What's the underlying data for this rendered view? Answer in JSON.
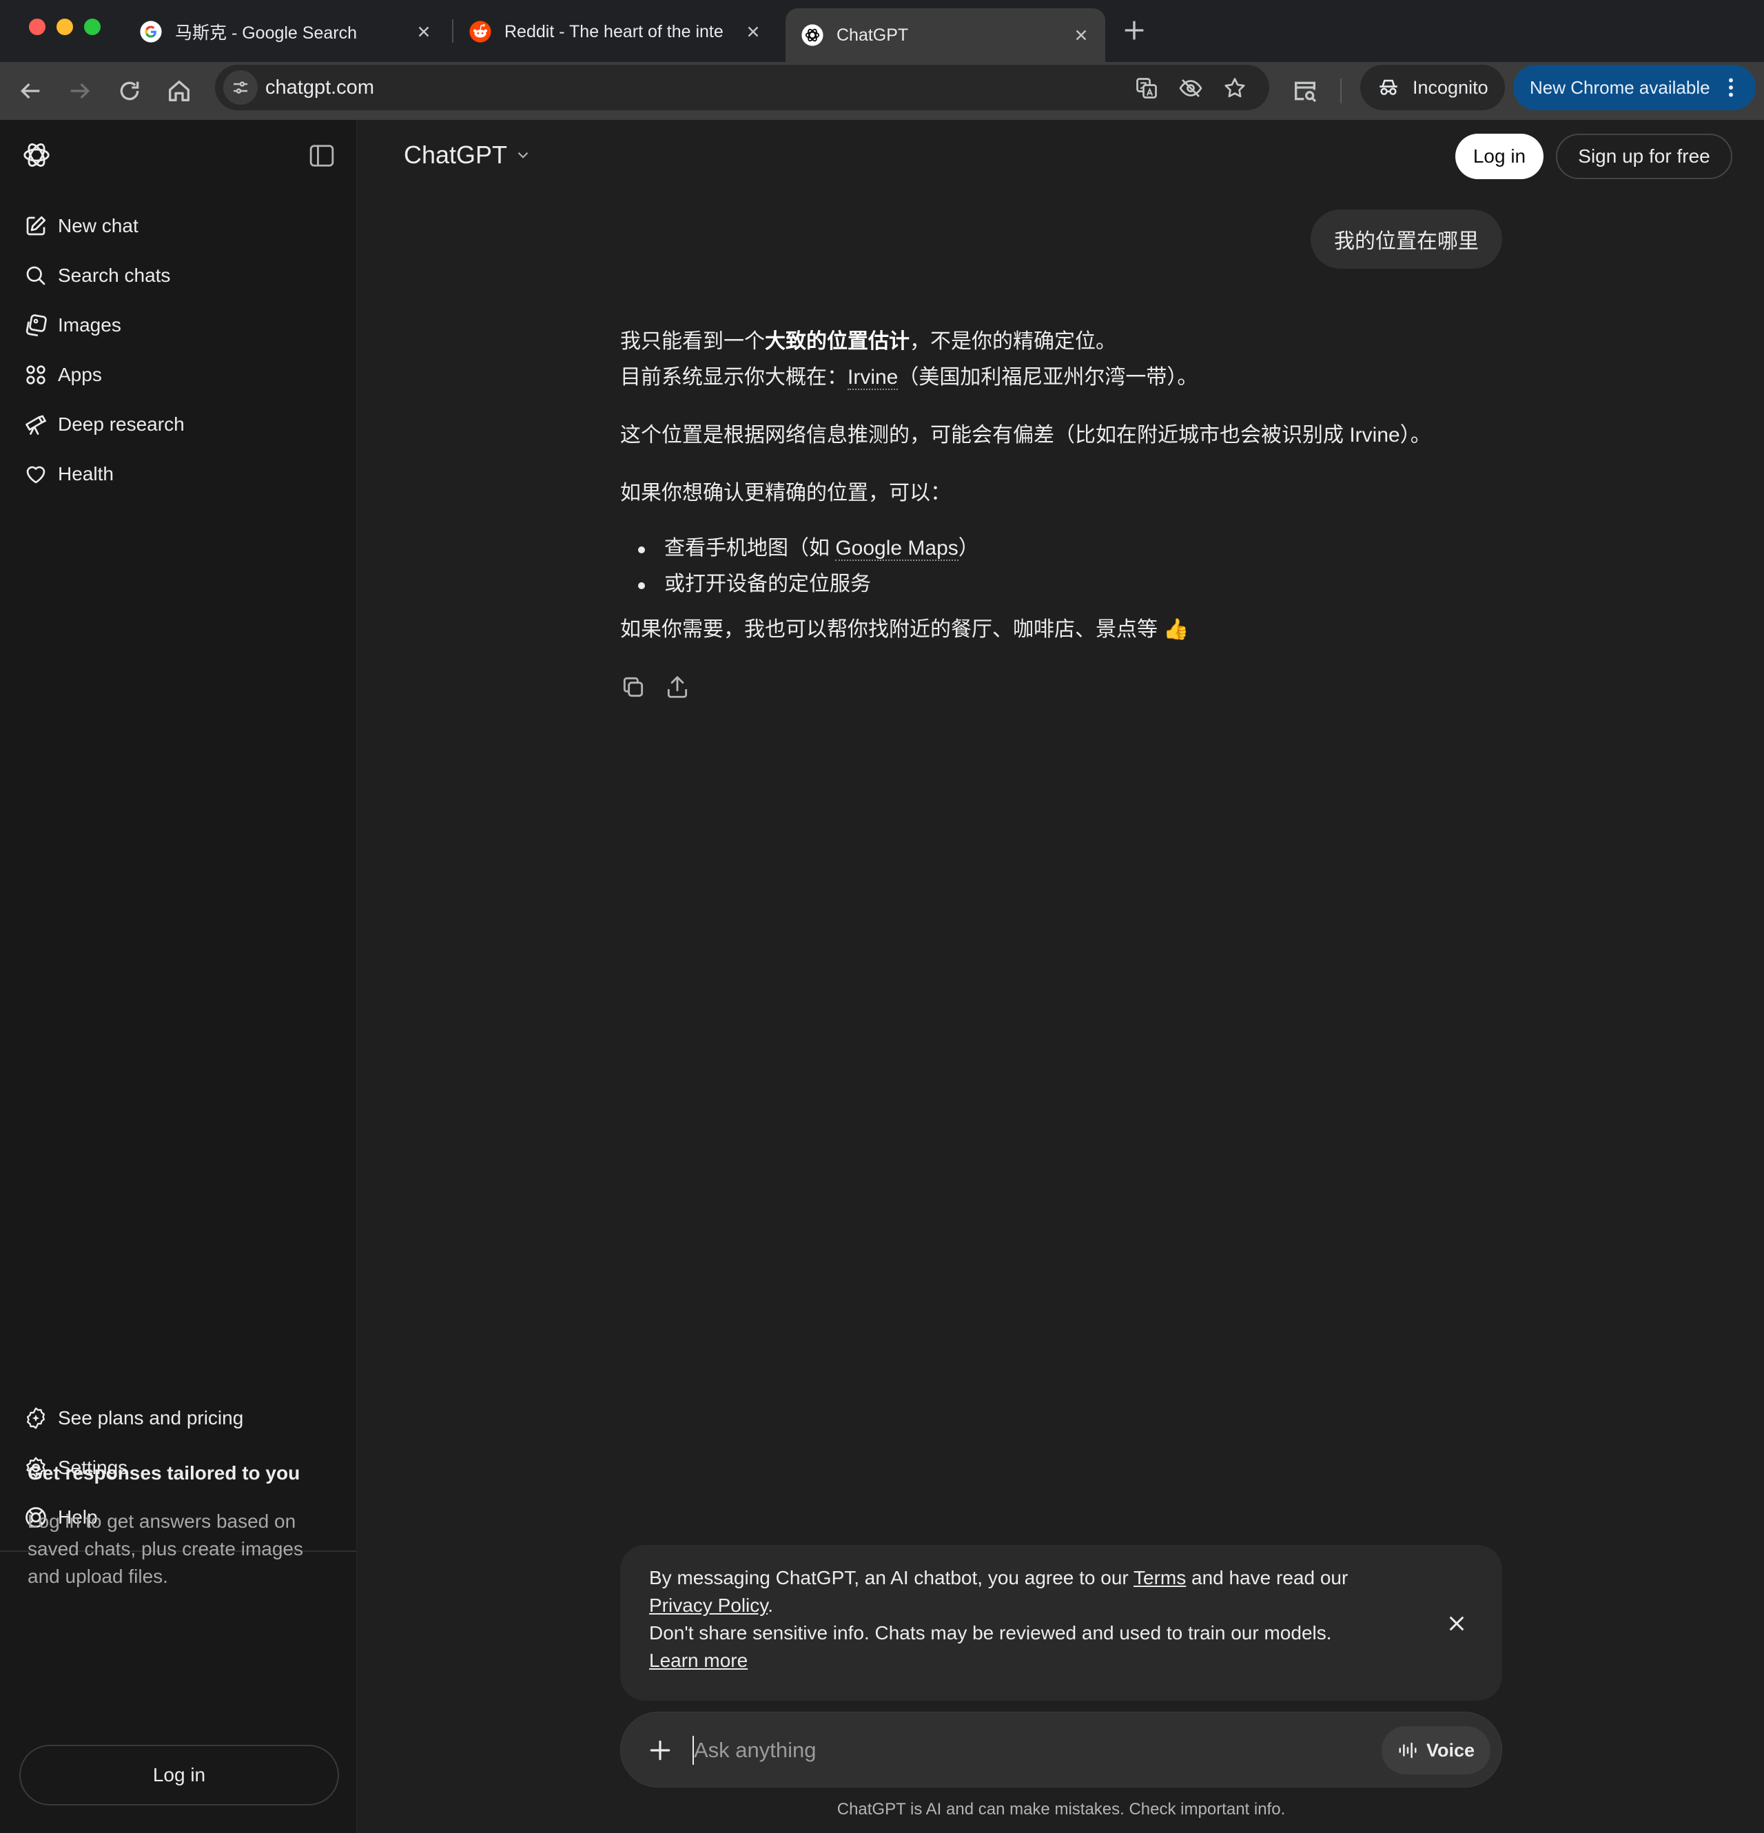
{
  "browser": {
    "tabs": [
      {
        "title": "马斯克 - Google Search",
        "icon": "google-icon"
      },
      {
        "title": "Reddit - The heart of the inte",
        "icon": "reddit-icon"
      },
      {
        "title": "ChatGPT",
        "icon": "chatgpt-icon",
        "active": true
      }
    ],
    "url": "chatgpt.com",
    "incognito_label": "Incognito",
    "update_label": "New Chrome available"
  },
  "sidebar": {
    "nav": [
      {
        "label": "New chat",
        "icon": "compose-icon"
      },
      {
        "label": "Search chats",
        "icon": "search-icon"
      },
      {
        "label": "Images",
        "icon": "images-icon"
      },
      {
        "label": "Apps",
        "icon": "apps-icon"
      },
      {
        "label": "Deep research",
        "icon": "telescope-icon"
      },
      {
        "label": "Health",
        "icon": "heart-icon"
      }
    ],
    "bottom_nav": [
      {
        "label": "See plans and pricing",
        "icon": "sparkle-badge-icon"
      },
      {
        "label": "Settings",
        "icon": "gear-icon"
      },
      {
        "label": "Help",
        "icon": "lifebuoy-icon"
      }
    ],
    "promo": {
      "title": "Get responses tailored to you",
      "text": "Log in to get answers based on saved chats, plus create images and upload files.",
      "login_label": "Log in"
    }
  },
  "header": {
    "model_label": "ChatGPT",
    "login_label": "Log in",
    "signup_label": "Sign up for free"
  },
  "conversation": {
    "user_message": "我的位置在哪里",
    "answer": {
      "p1_pre": "我只能看到一个",
      "p1_bold": "大致的位置估计",
      "p1_post": "，不是你的精确定位。",
      "p2_pre": "目前系统显示你大概在：",
      "p2_link": "Irvine",
      "p2_post": "（美国加利福尼亚州尔湾一带）。",
      "p3": "这个位置是根据网络信息推测的，可能会有偏差（比如在附近城市也会被识别成 Irvine）。",
      "p4": "如果你想确认更精确的位置，可以：",
      "bullet1_pre": "查看手机地图（如 ",
      "bullet1_link": "Google Maps",
      "bullet1_post": "）",
      "bullet2": "或打开设备的定位服务",
      "p5": "如果你需要，我也可以帮你找附近的餐厅、咖啡店、景点等 👍"
    }
  },
  "notice": {
    "text1": "By messaging ChatGPT, an AI chatbot, you agree to our ",
    "terms": "Terms",
    "text2": " and have read our ",
    "privacy": "Privacy Policy",
    "text3": ".",
    "text4": "Don't share sensitive info. Chats may be reviewed and used to train our models. ",
    "learn_more": "Learn more"
  },
  "composer": {
    "placeholder": "Ask anything",
    "voice_label": "Voice"
  },
  "disclaimer": "ChatGPT is AI and can make mistakes. Check important info."
}
